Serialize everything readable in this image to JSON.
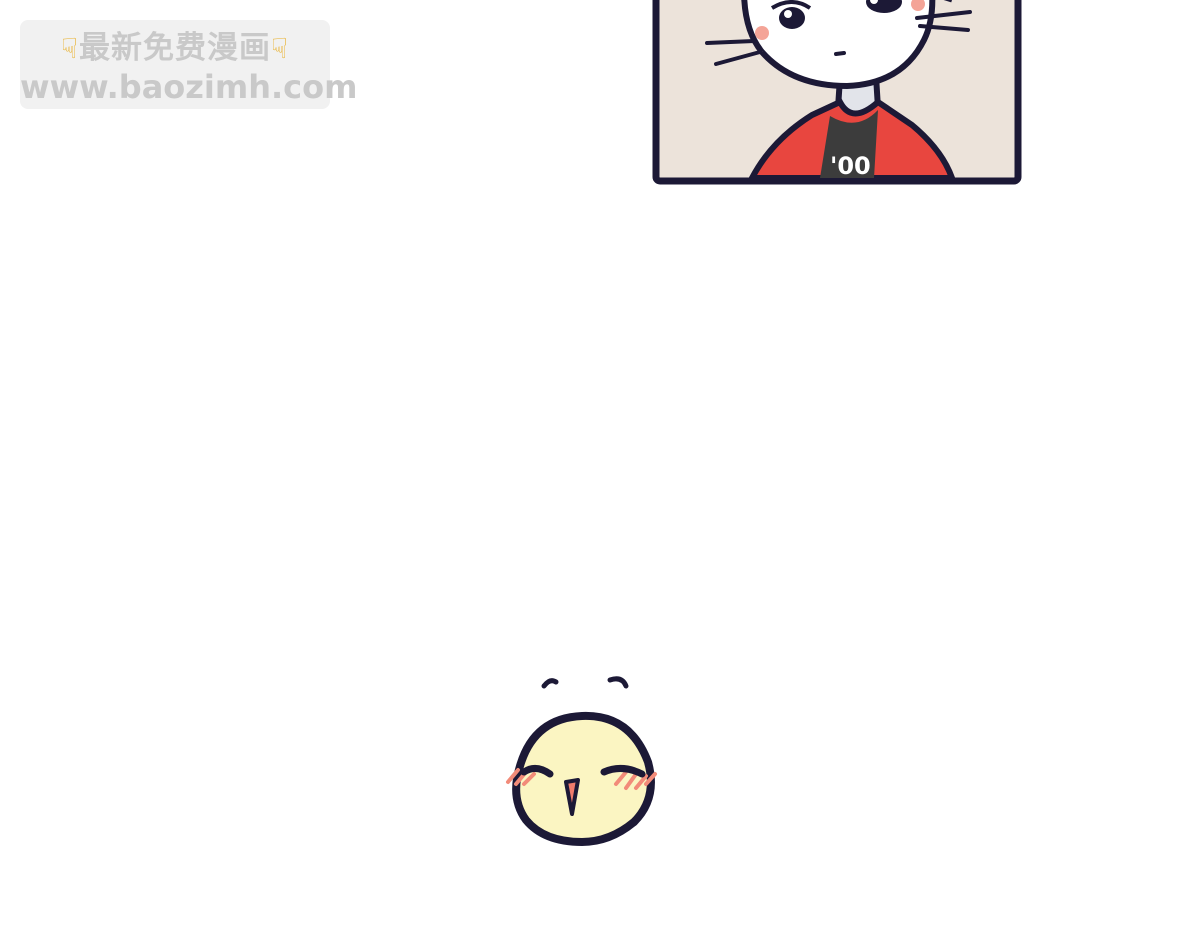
{
  "watermark": {
    "line1_text": "最新免费漫画",
    "line2_text": "www.baozimh.com",
    "hand_icon": "pointing-down-hand-icon"
  },
  "panel": {
    "shirt_text": "'00",
    "colors": {
      "background": "#ece3da",
      "border": "#1c1936",
      "jacket": "#e8463f",
      "shirt": "#3c3c3c"
    }
  },
  "chick": {
    "colors": {
      "body": "#fbf5c2",
      "outline": "#1c1936",
      "blush": "#f28b79",
      "beak": "#f07c6c"
    }
  }
}
